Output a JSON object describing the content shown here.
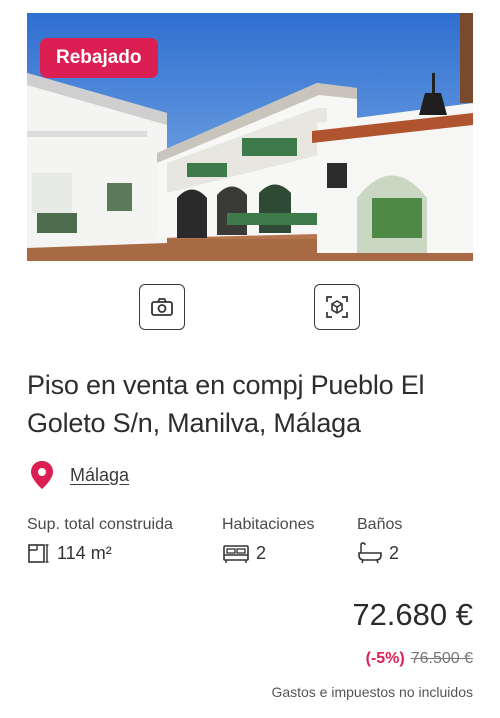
{
  "listing": {
    "badge": "Rebajado",
    "title": "Piso en venta en compj Pueblo El Goleto S/n, Manilva, Málaga",
    "location": "Málaga",
    "features": {
      "area_label": "Sup. total construida",
      "area_value": "114 m²",
      "rooms_label": "Habitaciones",
      "rooms_value": "2",
      "baths_label": "Baños",
      "baths_value": "2"
    },
    "price": "72.680 €",
    "discount": "(-5%)",
    "old_price": "76.500 €",
    "taxes_note": "Gastos e impuestos no incluidos"
  },
  "icons": {
    "photos": "camera-icon",
    "tour": "3d-cube-icon",
    "location": "map-pin-icon",
    "area": "floor-plan-icon",
    "rooms": "bed-icon",
    "baths": "bathtub-icon"
  },
  "colors": {
    "accent": "#dc1f52",
    "text": "#2b2b2b"
  }
}
